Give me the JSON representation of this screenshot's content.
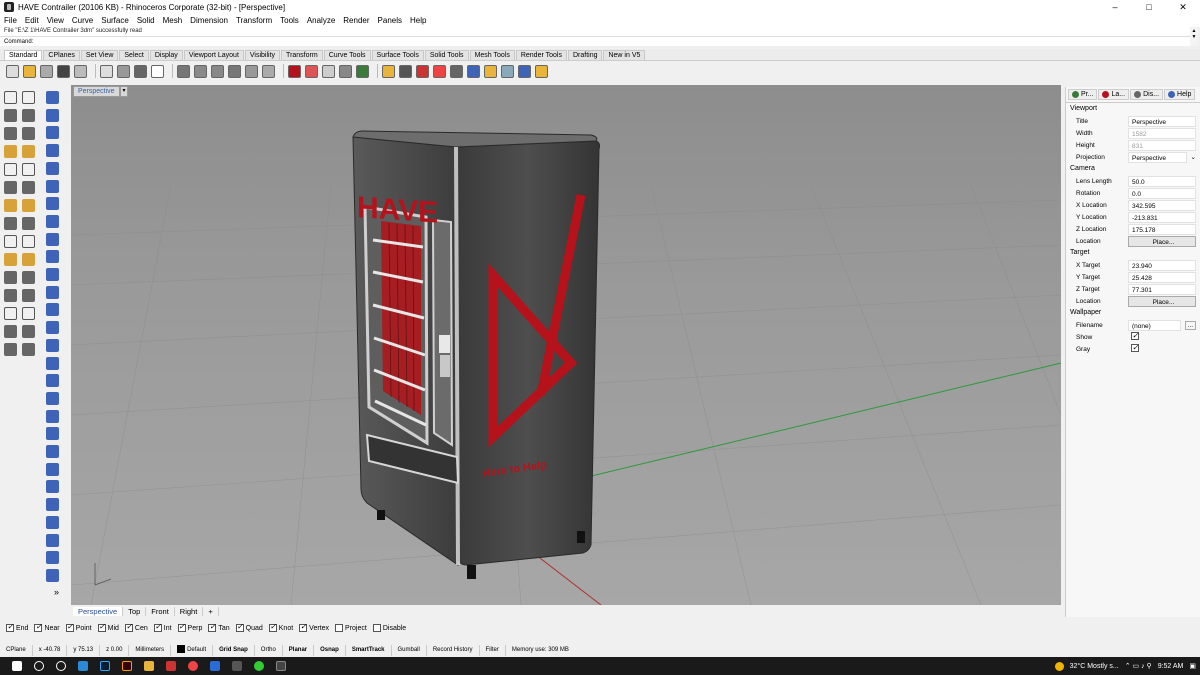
{
  "window": {
    "title": "HAVE Contrailer (20106 KB) - Rhinoceros Corporate (32-bit) - [Perspective]",
    "controls": [
      "–",
      "□",
      "✕"
    ]
  },
  "menu": [
    "File",
    "Edit",
    "View",
    "Curve",
    "Surface",
    "Solid",
    "Mesh",
    "Dimension",
    "Transform",
    "Tools",
    "Analyze",
    "Render",
    "Panels",
    "Help"
  ],
  "command": {
    "history": "File \"E:\\Z 1\\HAVE Contrailer 3dm\" successfully read",
    "prompt": "Command:"
  },
  "toolbar_tabs": [
    "Standard",
    "CPlanes",
    "Set View",
    "Select",
    "Display",
    "Viewport Layout",
    "Visibility",
    "Transform",
    "Curve Tools",
    "Surface Tools",
    "Solid Tools",
    "Mesh Tools",
    "Render Tools",
    "Drafting",
    "New in V5"
  ],
  "viewport": {
    "label": "Perspective",
    "dropdown": "▾",
    "model": {
      "logo_text": "HAVE",
      "slogan": "Here to Help"
    }
  },
  "view_tabs": [
    "Perspective",
    "Top",
    "Front",
    "Right",
    "+"
  ],
  "panel": {
    "tabs": [
      "Pr...",
      "La...",
      "Dis...",
      "Help"
    ],
    "sections": {
      "viewport": {
        "heading": "Viewport",
        "rows": [
          {
            "k": "Title",
            "v": "Perspective"
          },
          {
            "k": "Width",
            "v": "1582"
          },
          {
            "k": "Height",
            "v": "831"
          },
          {
            "k": "Projection",
            "v": "Perspective"
          }
        ]
      },
      "camera": {
        "heading": "Camera",
        "rows": [
          {
            "k": "Lens Length",
            "v": "50.0"
          },
          {
            "k": "Rotation",
            "v": "0.0"
          },
          {
            "k": "X Location",
            "v": "342.595"
          },
          {
            "k": "Y Location",
            "v": "-213.831"
          },
          {
            "k": "Z Location",
            "v": "175.178"
          },
          {
            "k": "Location",
            "v": "Place..."
          }
        ]
      },
      "target": {
        "heading": "Target",
        "rows": [
          {
            "k": "X Target",
            "v": "23.940"
          },
          {
            "k": "Y Target",
            "v": "25.428"
          },
          {
            "k": "Z Target",
            "v": "77.301"
          },
          {
            "k": "Location",
            "v": "Place..."
          }
        ]
      },
      "wallpaper": {
        "heading": "Wallpaper",
        "rows": [
          {
            "k": "Filename",
            "v": "(none)"
          },
          {
            "k": "Show",
            "v": ""
          },
          {
            "k": "Gray",
            "v": ""
          }
        ]
      }
    }
  },
  "osnap": [
    {
      "label": "End",
      "checked": true
    },
    {
      "label": "Near",
      "checked": true
    },
    {
      "label": "Point",
      "checked": true
    },
    {
      "label": "Mid",
      "checked": true
    },
    {
      "label": "Cen",
      "checked": true
    },
    {
      "label": "Int",
      "checked": true
    },
    {
      "label": "Perp",
      "checked": true
    },
    {
      "label": "Tan",
      "checked": true
    },
    {
      "label": "Quad",
      "checked": true
    },
    {
      "label": "Knot",
      "checked": true
    },
    {
      "label": "Vertex",
      "checked": true
    },
    {
      "label": "Project",
      "checked": false
    },
    {
      "label": "Disable",
      "checked": false
    }
  ],
  "status": {
    "cplane": "CPlane",
    "x": "x -40.78",
    "y": "y 75.13",
    "z": "z 0.00",
    "units": "Millimeters",
    "layer": "Default",
    "toggles": [
      "Grid Snap",
      "Ortho",
      "Planar",
      "Osnap",
      "SmartTrack",
      "Gumball",
      "Record History",
      "Filter"
    ],
    "memory": "Memory use: 309 MB"
  },
  "taskbar": {
    "weather": "32°C  Mostly s...",
    "time": "9:52 AM"
  },
  "colors": {
    "accent_blue": "#3f63b6",
    "brand_red": "#b5121b",
    "viewport_bg": "#9a9a9a"
  }
}
